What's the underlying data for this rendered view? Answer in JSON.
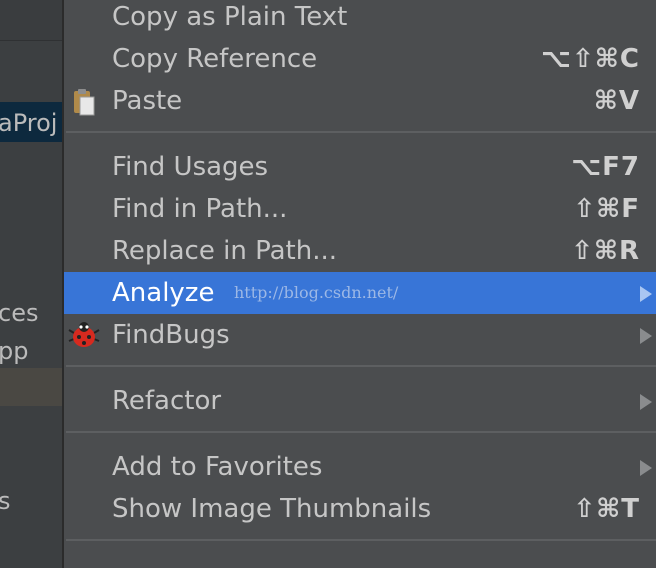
{
  "sidebar": {
    "project_fragment": "aProj",
    "item_fragment_1": "ces",
    "item_fragment_2": "pp",
    "item_fragment_3": "s"
  },
  "menu": {
    "copy_plain": {
      "label": "Copy as Plain Text"
    },
    "copy_reference": {
      "label": "Copy Reference",
      "shortcut": "⌥⇧⌘C"
    },
    "paste": {
      "label": "Paste",
      "shortcut": "⌘V",
      "icon": "clipboard-icon"
    },
    "find_usages": {
      "label": "Find Usages",
      "shortcut": "⌥F7"
    },
    "find_in_path": {
      "label": "Find in Path...",
      "shortcut": "⇧⌘F"
    },
    "replace_in_path": {
      "label": "Replace in Path...",
      "shortcut": "⇧⌘R"
    },
    "analyze": {
      "label": "Analyze",
      "watermark": "http://blog.csdn.net/"
    },
    "findbugs": {
      "label": "FindBugs",
      "icon": "ladybug-icon"
    },
    "refactor": {
      "label": "Refactor"
    },
    "add_favorites": {
      "label": "Add to Favorites"
    },
    "thumbnails": {
      "label": "Show Image Thumbnails",
      "shortcut": "⇧⌘T"
    }
  },
  "colors": {
    "menu_bg": "#4b4d4f",
    "selected_bg": "#3875d7",
    "text": "#c6c6c6"
  }
}
